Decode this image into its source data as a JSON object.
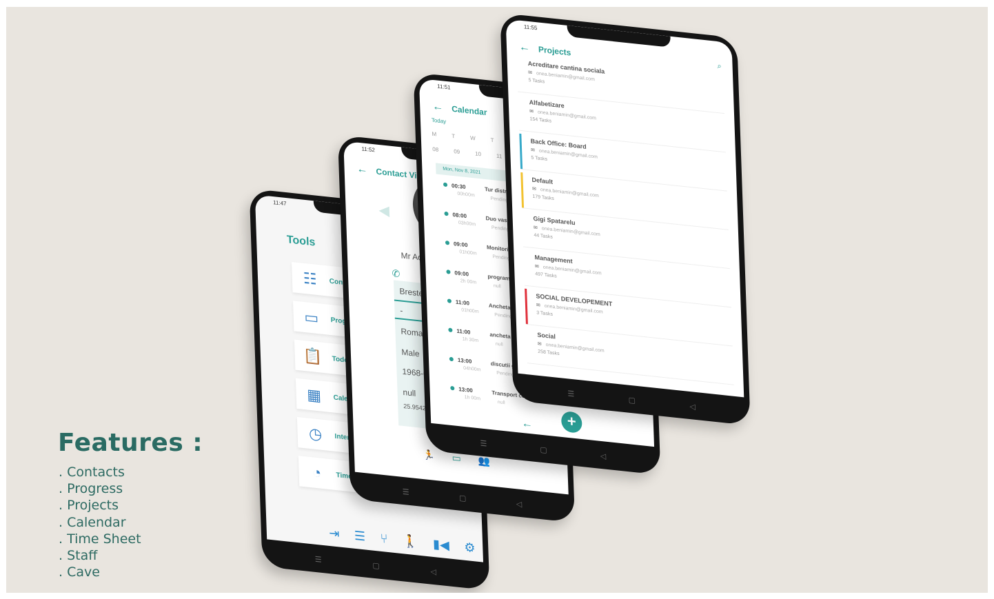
{
  "features": {
    "title": "Features :",
    "items": [
      ". Contacts",
      ". Progress",
      ". Projects",
      ". Calendar",
      ". Time Sheet",
      ". Staff",
      ". Cave"
    ]
  },
  "tools_screen": {
    "time": "11:47",
    "title": "Tools",
    "items": [
      "Contacts",
      "Progress",
      "Todo",
      "Calendar",
      "Intervention",
      "TimeSheet"
    ]
  },
  "contact_screen": {
    "time": "11:52",
    "title": "Contact View",
    "name": "Mr Adrian Bu",
    "address": "Brestei 471 Dolj",
    "dash": "-",
    "country": "Romania",
    "gender": "Male",
    "birth": "1968-06-02",
    "extra": "null",
    "coord": "25.9542089"
  },
  "calendar_screen": {
    "time": "11:51",
    "title": "Calendar",
    "today": "Today",
    "weekdays": [
      "M",
      "T",
      "W",
      "T"
    ],
    "days": [
      "08",
      "09",
      "10",
      "11"
    ],
    "date_header": "Mon, Nov 8, 2021",
    "events": [
      {
        "time": "00:30",
        "name": "Tur distribuire meniu",
        "duration": "00h00m",
        "status": "Pending"
      },
      {
        "time": "08:00",
        "name": "Duo vasele curatenie",
        "duration": "03h00m",
        "status": "Pending"
      },
      {
        "time": "09:00",
        "name": "Monitorizari",
        "duration": "01h00m",
        "status": "Pending"
      },
      {
        "time": "09:00",
        "name": "programare medicala",
        "duration": "2h 00m",
        "status": "null"
      },
      {
        "time": "11:00",
        "name": "Ancheta si donatie h",
        "duration": "01h00m",
        "status": "Pending"
      },
      {
        "time": "11:00",
        "name": "ancheta scoala+vizit",
        "duration": "1h 30m",
        "status": "null"
      },
      {
        "time": "13:00",
        "name": "discutii gr. 1+discutii",
        "duration": "04h00m",
        "status": "Pending"
      },
      {
        "time": "13:00",
        "name": "Transport copii",
        "duration": "1h 00m",
        "status": "null"
      }
    ]
  },
  "projects_screen": {
    "time": "11:55",
    "title": "Projects",
    "items": [
      {
        "name": "Acreditare cantina sociala",
        "email": "onea.beniamin@gmail.com",
        "tasks": "5 Tasks",
        "color": ""
      },
      {
        "name": "Alfabetizare",
        "email": "onea.beniamin@gmail.com",
        "tasks": "154 Tasks",
        "color": ""
      },
      {
        "name": "Back Office: Board",
        "email": "onea.beniamin@gmail.com",
        "tasks": "5 Tasks",
        "color": "#36a9c9"
      },
      {
        "name": "Default",
        "email": "onea.beniamin@gmail.com",
        "tasks": "179 Tasks",
        "color": "#f2c230"
      },
      {
        "name": "Gigi Spatarelu",
        "email": "onea.beniamin@gmail.com",
        "tasks": "44 Tasks",
        "color": ""
      },
      {
        "name": "Management",
        "email": "onea.beniamin@gmail.com",
        "tasks": "497 Tasks",
        "color": ""
      },
      {
        "name": "SOCIAL DEVELOPEMENT",
        "email": "onea.beniamin@gmail.com",
        "tasks": "3 Tasks",
        "color": "#e0303b"
      },
      {
        "name": "Social",
        "email": "onea.beniamin@gmail.com",
        "tasks": "258 Tasks",
        "color": ""
      }
    ]
  },
  "colors": {
    "accent": "#2a9d94",
    "heading": "#2a6b63",
    "background": "#e9e5df"
  }
}
